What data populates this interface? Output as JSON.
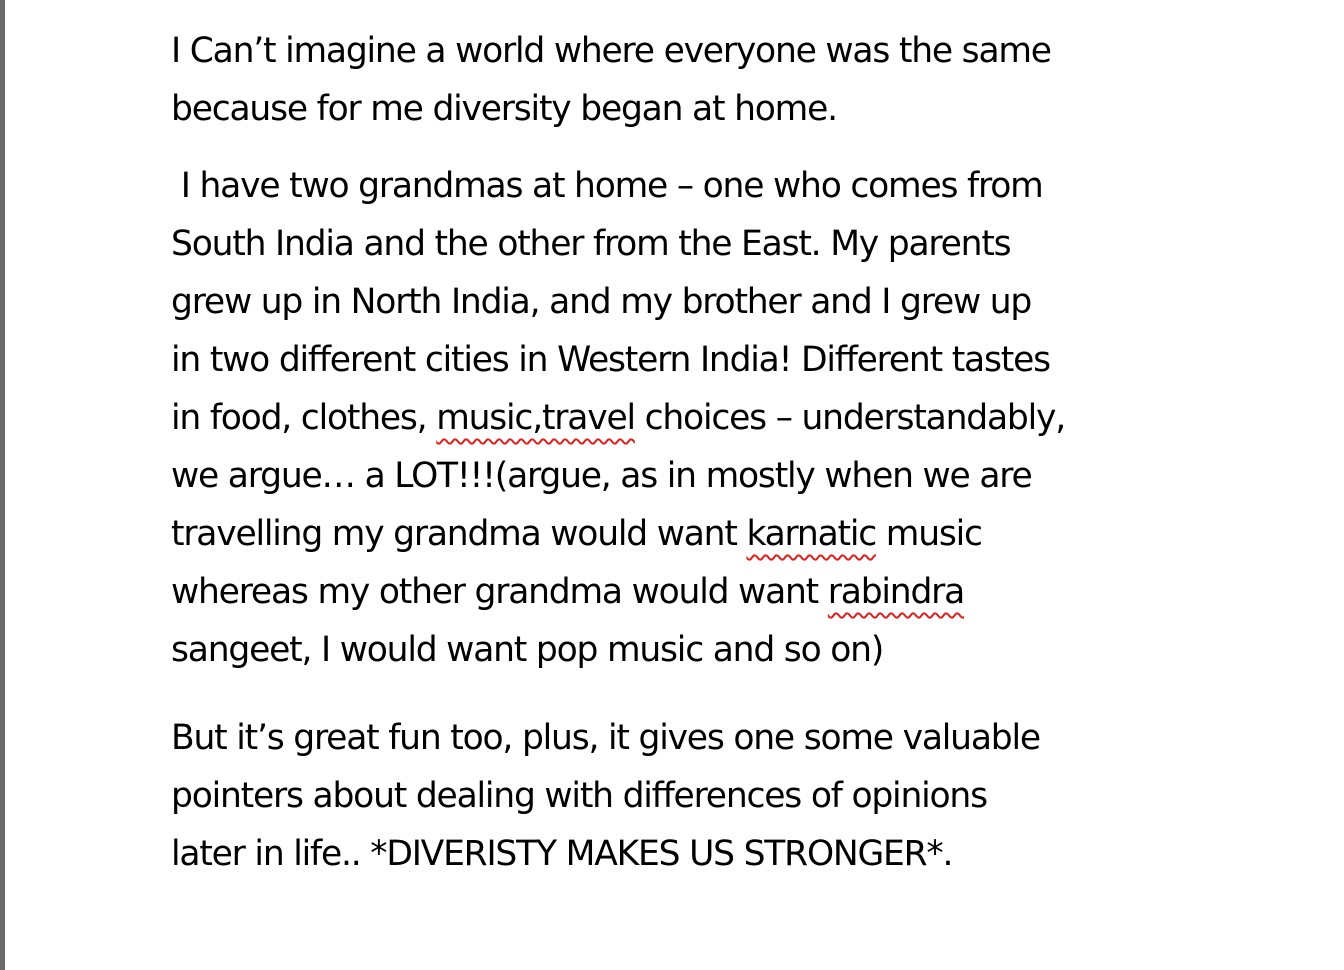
{
  "document": {
    "paragraphs": [
      {
        "lines": [
          "I Can’t imagine a world where everyone was the same",
          "because for me diversity began at home."
        ]
      },
      {
        "lines": [
          " I have two grandmas at home – one who comes from",
          "South India and the other from the East. My parents",
          "grew up in North India, and my brother and I grew up",
          "in two different cities in Western India! Different tastes",
          {
            "before": "in food, clothes, ",
            "flagged": "music,travel",
            "after": " choices – understandably,"
          },
          "we argue… a LOT!!!(argue, as in mostly when we are",
          {
            "before": "travelling my grandma would want ",
            "flagged": "karnatic",
            "after": " music"
          },
          {
            "before": "whereas my other grandma would want ",
            "flagged": "rabindra",
            "after": ""
          },
          "sangeet, I would want pop music and so on)"
        ]
      },
      {
        "lines": [
          "But it’s great fun too, plus, it gives one some valuable",
          "pointers about dealing with differences of opinions",
          "later in life.. *DIVERISTY MAKES US STRONGER*."
        ]
      }
    ],
    "spellcheck_color": "#e0201c",
    "text_color": "#000000"
  }
}
